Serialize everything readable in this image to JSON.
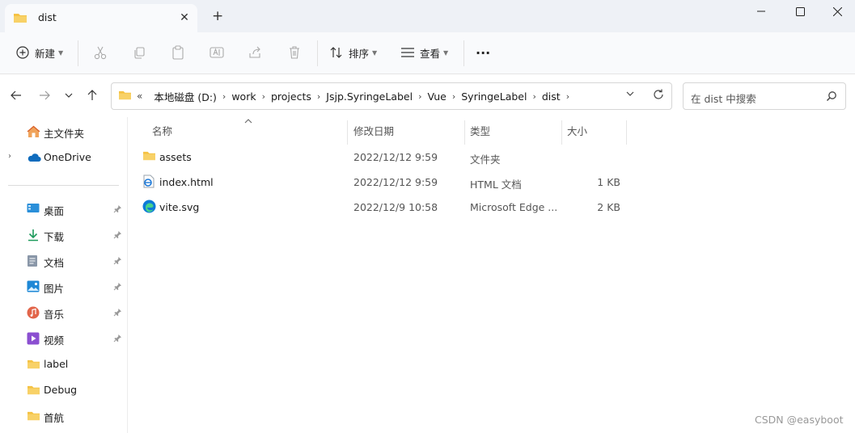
{
  "window": {
    "tab_title": "dist",
    "new_tab_glyph": "+"
  },
  "toolbar": {
    "new_label": "新建",
    "sort_label": "排序",
    "view_label": "查看",
    "more_glyph": "···"
  },
  "address": {
    "overflow": "«",
    "crumbs": [
      "本地磁盘 (D:)",
      "work",
      "projects",
      "Jsjp.SyringeLabel",
      "Vue",
      "SyringeLabel",
      "dist"
    ]
  },
  "search": {
    "placeholder": "在 dist 中搜索"
  },
  "sidebar": {
    "home": "主文件夹",
    "onedrive": "OneDrive",
    "quick": [
      {
        "label": "桌面",
        "icon": "desktop-icon"
      },
      {
        "label": "下载",
        "icon": "download-icon"
      },
      {
        "label": "文档",
        "icon": "document-icon"
      },
      {
        "label": "图片",
        "icon": "picture-icon"
      },
      {
        "label": "音乐",
        "icon": "music-icon"
      },
      {
        "label": "视频",
        "icon": "video-icon"
      }
    ],
    "folders": [
      "label",
      "Debug",
      "首航"
    ]
  },
  "columns": {
    "name": "名称",
    "date": "修改日期",
    "type": "类型",
    "size": "大小"
  },
  "files": [
    {
      "name": "assets",
      "date": "2022/12/12 9:59",
      "type": "文件夹",
      "size": ""
    },
    {
      "name": "index.html",
      "date": "2022/12/12 9:59",
      "type": "HTML 文档",
      "size": "1 KB"
    },
    {
      "name": "vite.svg",
      "date": "2022/12/9 10:58",
      "type": "Microsoft Edge ...",
      "size": "2 KB"
    }
  ],
  "watermark": "CSDN @easyboot",
  "colors": {
    "folder": "#f5c244",
    "accent": "#0067c0"
  }
}
